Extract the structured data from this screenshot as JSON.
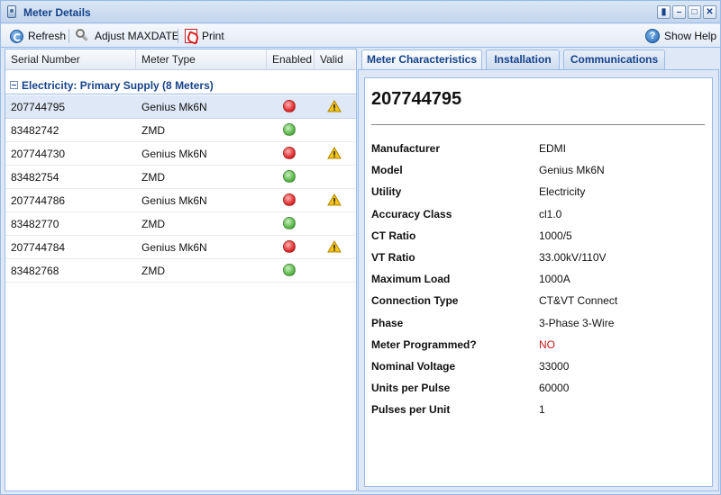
{
  "window": {
    "title": "Meter Details"
  },
  "toolbar": {
    "refresh": "Refresh",
    "adjust": "Adjust MAXDATE",
    "print": "Print",
    "help": "Show Help"
  },
  "grid": {
    "columns": [
      "Serial Number",
      "Meter Type",
      "Enabled",
      "Valid"
    ],
    "group": "Electricity: Primary Supply (8 Meters)",
    "rows": [
      {
        "serial": "207744795",
        "type": "Genius Mk6N",
        "enabled": "red",
        "warning": true
      },
      {
        "serial": "83482742",
        "type": "ZMD",
        "enabled": "green",
        "warning": false
      },
      {
        "serial": "207744730",
        "type": "Genius Mk6N",
        "enabled": "red",
        "warning": true
      },
      {
        "serial": "83482754",
        "type": "ZMD",
        "enabled": "green",
        "warning": false
      },
      {
        "serial": "207744786",
        "type": "Genius Mk6N",
        "enabled": "red",
        "warning": true
      },
      {
        "serial": "83482770",
        "type": "ZMD",
        "enabled": "green",
        "warning": false
      },
      {
        "serial": "207744784",
        "type": "Genius Mk6N",
        "enabled": "red",
        "warning": true
      },
      {
        "serial": "83482768",
        "type": "ZMD",
        "enabled": "green",
        "warning": false
      }
    ]
  },
  "tabs": [
    "Meter Characteristics",
    "Installation",
    "Communications"
  ],
  "detail": {
    "serial": "207744795",
    "properties": [
      {
        "label": "Manufacturer",
        "value": "EDMI"
      },
      {
        "label": "Model",
        "value": "Genius Mk6N"
      },
      {
        "label": "Utility",
        "value": "Electricity"
      },
      {
        "label": "Accuracy Class",
        "value": "cl1.0"
      },
      {
        "label": "CT Ratio",
        "value": "1000/5"
      },
      {
        "label": "VT Ratio",
        "value": "33.00kV/110V"
      },
      {
        "label": "Maximum Load",
        "value": "1000A"
      },
      {
        "label": "Connection Type",
        "value": "CT&VT Connect"
      },
      {
        "label": "Phase",
        "value": "3-Phase 3-Wire"
      },
      {
        "label": "Meter Programmed?",
        "value": "NO"
      },
      {
        "label": "Nominal Voltage",
        "value": "33000"
      },
      {
        "label": "Units per Pulse",
        "value": "60000"
      },
      {
        "label": "Pulses per Unit",
        "value": "1"
      }
    ]
  },
  "colors": {
    "accent": "#15428b",
    "alert": "#c41a1a",
    "ok": "#5cb84c",
    "error": "#e03030"
  }
}
